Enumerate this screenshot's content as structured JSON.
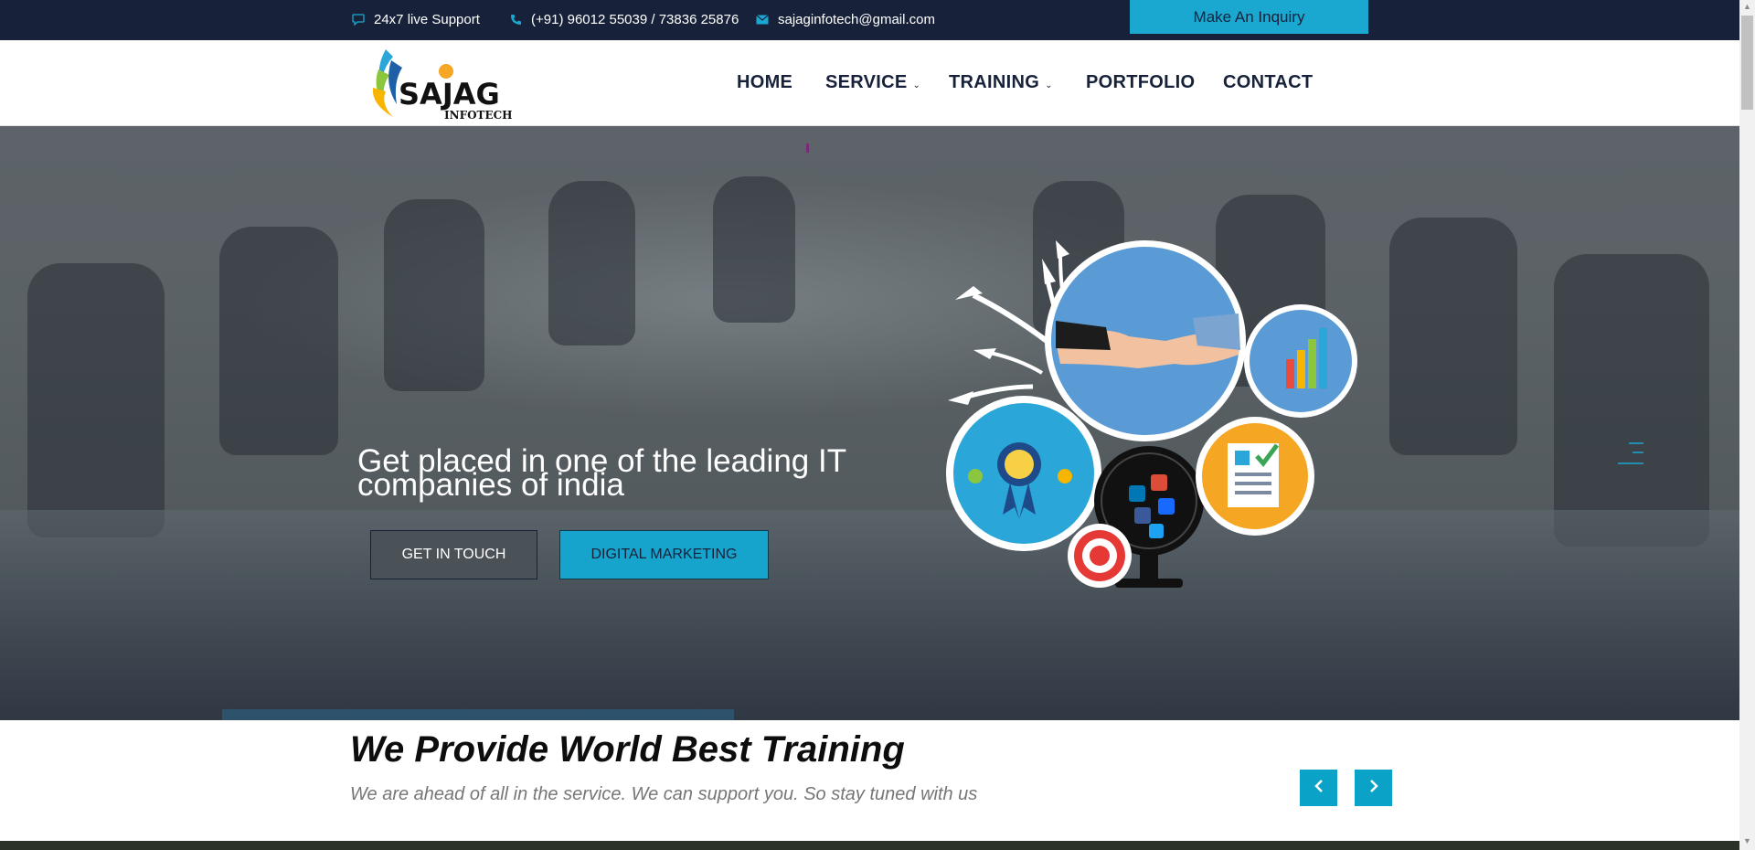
{
  "topbar": {
    "support": {
      "icon": "chat-bubble-icon",
      "text": "24x7 live Support"
    },
    "phone": {
      "icon": "phone-icon",
      "text": "(+91) 96012 55039 / 73836 25876"
    },
    "email": {
      "icon": "envelope-icon",
      "text": "sajaginfotech@gmail.com"
    },
    "inquiry_button": "Make An Inquiry"
  },
  "header": {
    "logo": {
      "name": "SAJAG",
      "tagline": "INFOTECH"
    },
    "nav": [
      {
        "label": "HOME"
      },
      {
        "label": "SERVICE",
        "dropdown": true
      },
      {
        "label": "TRAINING",
        "dropdown": true
      },
      {
        "label": "PORTFOLIO"
      },
      {
        "label": "CONTACT"
      }
    ]
  },
  "hero": {
    "title_line1": "Get placed in one of the leading IT",
    "title_line2": "companies of india",
    "button_touch": "GET IN TOUCH",
    "button_dm": "DIGITAL MARKETING"
  },
  "section": {
    "title": "We Provide World Best Training",
    "subtitle": "We are ahead of all in the service. We can support you. So stay tuned with us"
  },
  "colors": {
    "dark": "#17223a",
    "accent": "#1aa8d1",
    "white": "#ffffff"
  }
}
